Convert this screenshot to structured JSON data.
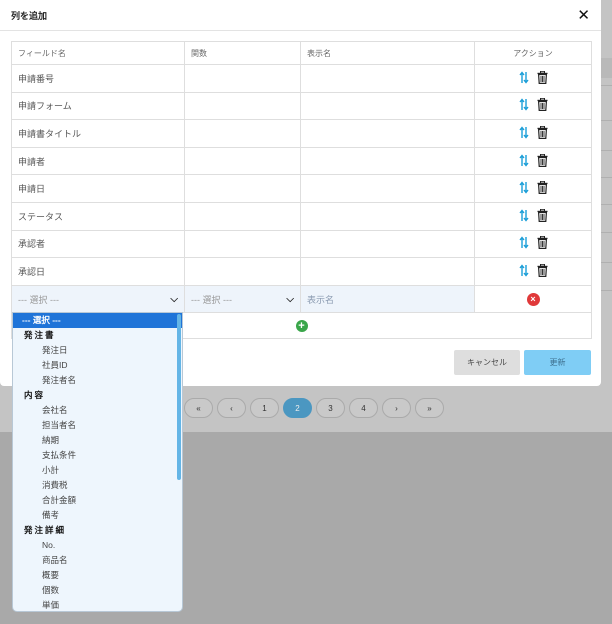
{
  "modal": {
    "title": "列を追加",
    "close_label": "✕",
    "columns": [
      "フィールド名",
      "関数",
      "表示名",
      "アクション"
    ],
    "rows": [
      {
        "field": "申請番号",
        "func": "",
        "display": ""
      },
      {
        "field": "申請フォーム",
        "func": "",
        "display": ""
      },
      {
        "field": "申請書タイトル",
        "func": "",
        "display": ""
      },
      {
        "field": "申請者",
        "func": "",
        "display": ""
      },
      {
        "field": "申請日",
        "func": "",
        "display": ""
      },
      {
        "field": "ステータス",
        "func": "",
        "display": ""
      },
      {
        "field": "承認者",
        "func": "",
        "display": ""
      },
      {
        "field": "承認日",
        "func": "",
        "display": ""
      }
    ],
    "new_row": {
      "field_select": "--- 選択 ---",
      "func_select": "--- 選択 ---",
      "display_placeholder": "表示名"
    },
    "cancel_label": "キャンセル",
    "update_label": "更新"
  },
  "pagination": [
    "«",
    "‹",
    "1",
    "2",
    "3",
    "4",
    "›",
    "»"
  ],
  "pagination_active": "2",
  "dropdown": {
    "items": [
      {
        "kind": "selected",
        "label": "--- 選択 ---"
      },
      {
        "kind": "group",
        "label": "発注書"
      },
      {
        "kind": "opt",
        "label": "発注日"
      },
      {
        "kind": "opt",
        "label": "社員ID"
      },
      {
        "kind": "opt",
        "label": "発注者名"
      },
      {
        "kind": "group",
        "label": "内容"
      },
      {
        "kind": "opt",
        "label": "会社名"
      },
      {
        "kind": "opt",
        "label": "担当者名"
      },
      {
        "kind": "opt",
        "label": "納期"
      },
      {
        "kind": "opt",
        "label": "支払条件"
      },
      {
        "kind": "opt",
        "label": "小計"
      },
      {
        "kind": "opt",
        "label": "消費税"
      },
      {
        "kind": "opt",
        "label": "合計金額"
      },
      {
        "kind": "opt",
        "label": "備考"
      },
      {
        "kind": "group",
        "label": "発注詳細"
      },
      {
        "kind": "opt",
        "label": "No."
      },
      {
        "kind": "opt",
        "label": "商品名"
      },
      {
        "kind": "opt",
        "label": "概要"
      },
      {
        "kind": "opt",
        "label": "個数"
      },
      {
        "kind": "opt",
        "label": "単価"
      }
    ]
  },
  "colors": {
    "accent": "#1f74d8",
    "update_button": "#7fcdf5",
    "delete_red": "#e0393a",
    "add_green": "#3aa64a",
    "sort_icon": "#1a9ed8"
  },
  "icons": {
    "sort": "sort-arrows-icon",
    "trash": "trash-icon",
    "remove": "remove-circle-icon",
    "add": "add-circle-icon",
    "chevron": "chevron-down-icon",
    "close": "close-icon"
  }
}
